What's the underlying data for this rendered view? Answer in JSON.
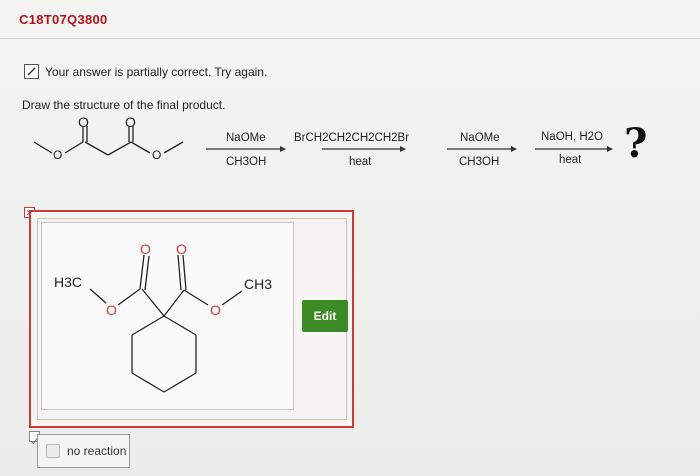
{
  "question": {
    "id": "C18T07Q3800",
    "status_message": "Your answer is partially correct.  Try again.",
    "prompt": "Draw the structure of the final product."
  },
  "reaction": {
    "step1": {
      "top": "NaOMe",
      "bottom": "CH3OH"
    },
    "step2": {
      "top": "BrCH2CH2CH2CH2Br",
      "bottom": "heat"
    },
    "step3": {
      "top": "NaOMe",
      "bottom": "CH3OH"
    },
    "step4": {
      "top": "NaOH, H2O",
      "bottom": "heat"
    },
    "product_symbol": "?"
  },
  "answer": {
    "structure_labels": {
      "left_methyl": "H3C",
      "right_methyl": "CH3",
      "oxygen": "O"
    },
    "edit_label": "Edit",
    "no_reaction_label": "no reaction"
  },
  "colors": {
    "accent_red": "#b0141c",
    "frame_red": "#c93a3a",
    "edit_green": "#3d8b26"
  },
  "icons": [
    "pencil-icon",
    "x-mark-icon",
    "check-icon"
  ]
}
